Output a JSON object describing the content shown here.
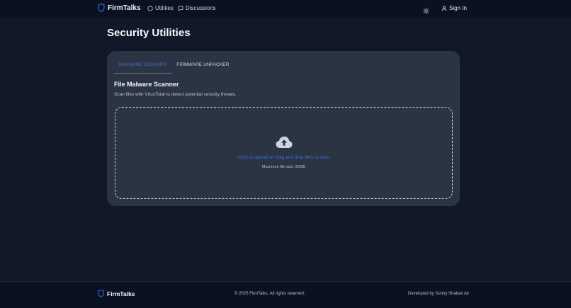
{
  "nav": {
    "brand": "FirmTalks",
    "utilities": "Utilities",
    "discussions": "Discussions",
    "signin": "Sign In"
  },
  "page": {
    "title": "Security Utilities"
  },
  "tabs": [
    {
      "label": "MALWARE SCANNER",
      "active": true
    },
    {
      "label": "FIRMWARE UNPACKER",
      "active": false
    }
  ],
  "scanner": {
    "title": "File Malware Scanner",
    "description": "Scan files with VirusTotal to detect potential security threats.",
    "upload_text": "Click to upload or drag and drop files to scan",
    "upload_hint": "Maximum file size: 32MB"
  },
  "footer": {
    "brand": "FirmTalks",
    "copyright": "© 2025 FirmTalks. All rights reserved.",
    "developed_by": "Developed by Sunny Shaban Ali"
  },
  "colors": {
    "background": "#111827",
    "navbar": "#0b1120",
    "card": "#2b3443",
    "accent": "#3b6fd8"
  },
  "icons": {
    "brand": "shield-icon",
    "utilities": "hexagon-icon",
    "discussions": "chat-bubble-icon",
    "theme": "sun-icon",
    "signin": "user-icon",
    "upload": "cloud-upload-icon"
  }
}
